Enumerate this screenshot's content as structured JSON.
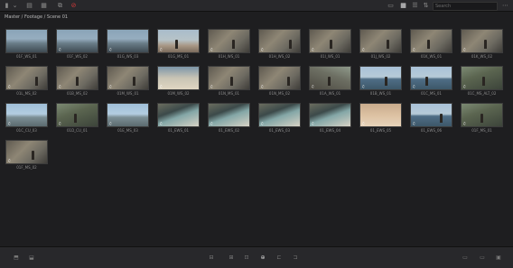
{
  "toolbar": {
    "search": {
      "placeholder": "Search",
      "value": ""
    },
    "icons": [
      "sidebar-icon",
      "dropdown-chevron-icon",
      "metadata-icon",
      "list-icon",
      "link-icon",
      "stop-icon"
    ],
    "view_icons": [
      "filmstrip-view-icon",
      "thumbnail-view-icon",
      "list-view-icon",
      "sort-icon",
      "menu-icon"
    ]
  },
  "breadcrumb": "Master / Footage / Scene 01",
  "clips": [
    {
      "name": "01F_WS_01",
      "scene": "set",
      "badge": ""
    },
    {
      "name": "01F_WS_02",
      "scene": "set",
      "badge": "♫"
    },
    {
      "name": "01G_WS_03",
      "scene": "set",
      "badge": "♫"
    },
    {
      "name": "01G_MS_01",
      "scene": "people",
      "badge": "♫"
    },
    {
      "name": "01H_WS_01",
      "scene": "rock",
      "badge": "♫"
    },
    {
      "name": "01H_WS_02",
      "scene": "rock",
      "badge": "♫"
    },
    {
      "name": "01I_WS_01",
      "scene": "rock",
      "badge": "♫"
    },
    {
      "name": "01J_WS_02",
      "scene": "rock",
      "badge": "♫"
    },
    {
      "name": "01K_WS_01",
      "scene": "rock",
      "badge": "♫"
    },
    {
      "name": "01K_WS_02",
      "scene": "rock",
      "badge": "♫"
    },
    {
      "name": "01L_MS_02",
      "scene": "rock",
      "badge": "♫"
    },
    {
      "name": "01B_MS_02",
      "scene": "rock",
      "badge": "♫"
    },
    {
      "name": "01M_WS_01",
      "scene": "rock",
      "badge": "♫"
    },
    {
      "name": "01M_WS_02",
      "scene": "beach",
      "badge": "♫"
    },
    {
      "name": "01N_MS_01",
      "scene": "rock",
      "badge": "♫"
    },
    {
      "name": "01N_MS_02",
      "scene": "rock",
      "badge": "♫"
    },
    {
      "name": "01A_WS_01",
      "scene": "rock2",
      "badge": "♫"
    },
    {
      "name": "01B_WS_01",
      "scene": "ocean",
      "badge": "♫"
    },
    {
      "name": "01C_MS_01",
      "scene": "ocean",
      "badge": "♫"
    },
    {
      "name": "01C_MS_ALT_02",
      "scene": "cliff",
      "badge": "♫"
    },
    {
      "name": "01C_CU_03",
      "scene": "sky",
      "badge": "♫"
    },
    {
      "name": "01D_CU_01",
      "scene": "cliff",
      "badge": "♫"
    },
    {
      "name": "01E_MS_03",
      "scene": "sky",
      "badge": "♫"
    },
    {
      "name": "01_EWS_01",
      "scene": "cove",
      "badge": "♫"
    },
    {
      "name": "01_EWS_02",
      "scene": "cove",
      "badge": "♫"
    },
    {
      "name": "01_EWS_03",
      "scene": "cove",
      "badge": "♫"
    },
    {
      "name": "01_EWS_04",
      "scene": "cove",
      "badge": "♫"
    },
    {
      "name": "01_EWS_05",
      "scene": "sand",
      "badge": "♫"
    },
    {
      "name": "01_EWS_06",
      "scene": "ocean",
      "badge": "♫"
    },
    {
      "name": "01F_MS_01",
      "scene": "cliff",
      "badge": "♫"
    },
    {
      "name": "01F_MS_02",
      "scene": "rock",
      "badge": "♫"
    }
  ],
  "bottombar": {
    "left_icons": [
      "import-icon",
      "export-icon"
    ],
    "center_icons": [
      "insert-clip-icon",
      "overwrite-clip-icon",
      "replace-clip-icon",
      "place-on-top-icon",
      "append-icon",
      "ripple-overwrite-icon"
    ],
    "right_icons": [
      "viewer-small-icon",
      "viewer-medium-icon",
      "viewer-large-icon"
    ]
  }
}
